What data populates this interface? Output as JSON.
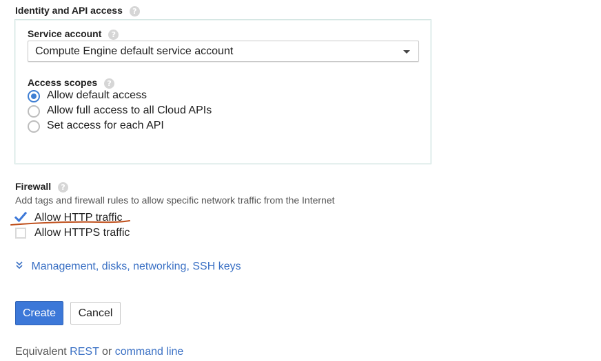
{
  "identity": {
    "title": "Identity and API access"
  },
  "service_account": {
    "label": "Service account",
    "selected": "Compute Engine default service account"
  },
  "access_scopes": {
    "label": "Access scopes",
    "options": [
      {
        "label": "Allow default access",
        "selected": true
      },
      {
        "label": "Allow full access to all Cloud APIs",
        "selected": false
      },
      {
        "label": "Set access for each API",
        "selected": false
      }
    ]
  },
  "firewall": {
    "title": "Firewall",
    "description": "Add tags and firewall rules to allow specific network traffic from the Internet",
    "options": [
      {
        "label": "Allow HTTP traffic",
        "checked": true
      },
      {
        "label": "Allow HTTPS traffic",
        "checked": false
      }
    ]
  },
  "expand_link": {
    "label": "Management, disks, networking, SSH keys"
  },
  "actions": {
    "create": "Create",
    "cancel": "Cancel"
  },
  "footer": {
    "prefix": "Equivalent",
    "rest": "REST",
    "or": "or",
    "command_line": "command line"
  },
  "help_glyph": "?",
  "colors": {
    "accent": "#3c78d8",
    "link": "#3a70c4",
    "annotation": "#c0521f"
  }
}
